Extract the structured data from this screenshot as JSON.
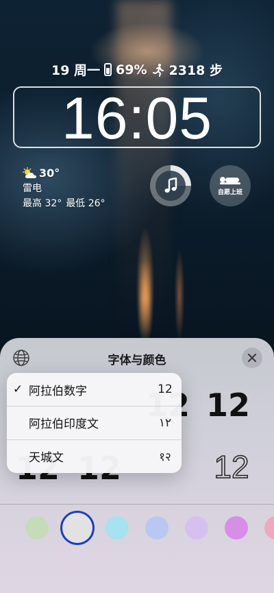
{
  "status": {
    "date": "19 周一",
    "battery": "69%",
    "steps": "2318 步"
  },
  "clock": {
    "time": "16:05"
  },
  "weather": {
    "temp": "30°",
    "condition": "雷电",
    "high": "最高 32°",
    "low": "最低 26°",
    "icon": "partly-cloudy-sun-icon"
  },
  "widgets": {
    "music_icon": "music-note-icon",
    "sleep_label": "自愿上班",
    "sleep_icon": "sleeping-person-icon"
  },
  "sheet": {
    "title": "字体与颜色",
    "globe_icon": "globe-icon",
    "close_icon": "close-icon",
    "font_samples": [
      "12",
      "12",
      "12",
      "12",
      "12"
    ]
  },
  "menu": {
    "items": [
      {
        "label": "阿拉伯数字",
        "sample": "12",
        "checked": true
      },
      {
        "label": "阿拉伯印度文",
        "sample": "١٢",
        "checked": false
      },
      {
        "label": "天城文",
        "sample": "१२",
        "checked": false
      }
    ],
    "check_mark": "✓"
  },
  "colors": {
    "swatches": [
      "#c6dcb8",
      "#e2e2e2",
      "#a6e2f0",
      "#b8c8f2",
      "#d6c0f0",
      "#d78ee8",
      "#f0a8c0"
    ],
    "selected_ring": "#1a3fb8"
  }
}
